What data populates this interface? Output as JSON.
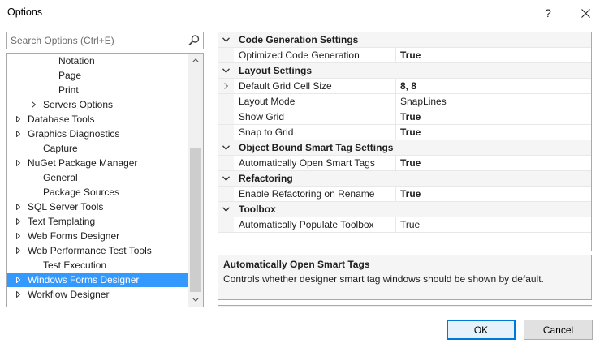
{
  "window": {
    "title": "Options"
  },
  "search": {
    "placeholder": "Search Options (Ctrl+E)"
  },
  "tree": {
    "items": [
      {
        "label": "Notation",
        "level": 4,
        "arrow": false,
        "selected": false
      },
      {
        "label": "Page",
        "level": 4,
        "arrow": false,
        "selected": false
      },
      {
        "label": "Print",
        "level": 4,
        "arrow": false,
        "selected": false
      },
      {
        "label": "Servers Options",
        "level": 3,
        "arrow": true,
        "selected": false
      },
      {
        "label": "Database Tools",
        "level": 1,
        "arrow": true,
        "selected": false
      },
      {
        "label": "Graphics Diagnostics",
        "level": 1,
        "arrow": true,
        "selected": false
      },
      {
        "label": "Capture",
        "level": 2,
        "arrow": false,
        "selected": false
      },
      {
        "label": "NuGet Package Manager",
        "level": 1,
        "arrow": true,
        "selected": false
      },
      {
        "label": "General",
        "level": 2,
        "arrow": false,
        "selected": false
      },
      {
        "label": "Package Sources",
        "level": 2,
        "arrow": false,
        "selected": false
      },
      {
        "label": "SQL Server Tools",
        "level": 1,
        "arrow": true,
        "selected": false
      },
      {
        "label": "Text Templating",
        "level": 1,
        "arrow": true,
        "selected": false
      },
      {
        "label": "Web Forms Designer",
        "level": 1,
        "arrow": true,
        "selected": false
      },
      {
        "label": "Web Performance Test Tools",
        "level": 1,
        "arrow": true,
        "selected": false
      },
      {
        "label": "Test Execution",
        "level": 2,
        "arrow": false,
        "selected": false
      },
      {
        "label": "Windows Forms Designer",
        "level": 1,
        "arrow": true,
        "selected": true
      },
      {
        "label": "Workflow Designer",
        "level": 1,
        "arrow": true,
        "selected": false
      }
    ]
  },
  "grid": {
    "rows": [
      {
        "type": "category",
        "label": "Code Generation Settings"
      },
      {
        "type": "prop",
        "name": "Optimized Code Generation",
        "value": "True",
        "bold": true,
        "expander": false
      },
      {
        "type": "category",
        "label": "Layout Settings"
      },
      {
        "type": "prop",
        "name": "Default Grid Cell Size",
        "value": "8, 8",
        "bold": true,
        "expander": true
      },
      {
        "type": "prop",
        "name": "Layout Mode",
        "value": "SnapLines",
        "bold": false,
        "expander": false
      },
      {
        "type": "prop",
        "name": "Show Grid",
        "value": "True",
        "bold": true,
        "expander": false
      },
      {
        "type": "prop",
        "name": "Snap to Grid",
        "value": "True",
        "bold": true,
        "expander": false
      },
      {
        "type": "category",
        "label": "Object Bound Smart Tag Settings"
      },
      {
        "type": "prop",
        "name": "Automatically Open Smart Tags",
        "value": "True",
        "bold": true,
        "expander": false
      },
      {
        "type": "category",
        "label": "Refactoring"
      },
      {
        "type": "prop",
        "name": "Enable Refactoring on Rename",
        "value": "True",
        "bold": true,
        "expander": false
      },
      {
        "type": "category",
        "label": "Toolbox"
      },
      {
        "type": "prop",
        "name": "Automatically Populate Toolbox",
        "value": "True",
        "bold": false,
        "expander": false
      }
    ]
  },
  "description": {
    "title": "Automatically Open Smart Tags",
    "text": "Controls whether designer smart tag windows should be shown by default."
  },
  "buttons": {
    "ok": "OK",
    "cancel": "Cancel",
    "help": "?"
  },
  "colors": {
    "selection": "#3399ff",
    "accent": "#0078d7"
  },
  "icons": {
    "search": "search-icon",
    "close": "close-icon",
    "help": "help-icon"
  }
}
